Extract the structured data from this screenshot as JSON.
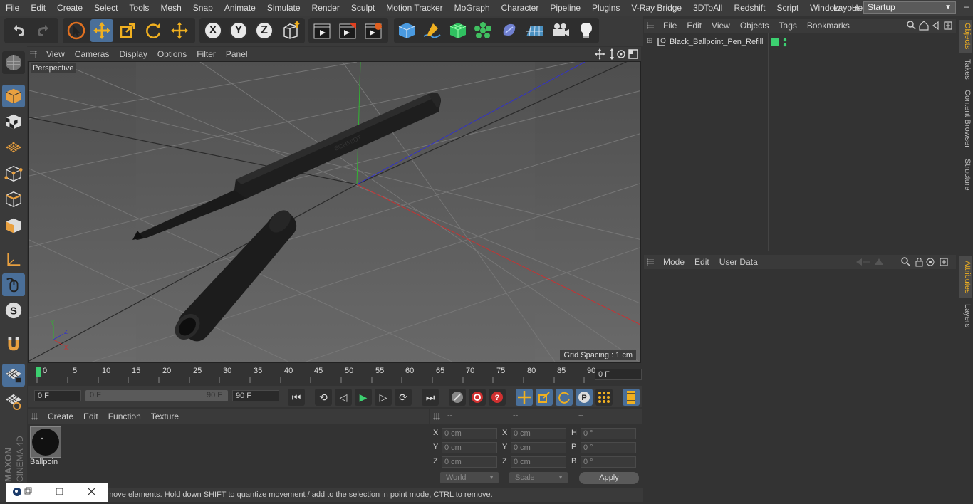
{
  "menubar": {
    "items": [
      "File",
      "Edit",
      "Create",
      "Select",
      "Tools",
      "Mesh",
      "Snap",
      "Animate",
      "Simulate",
      "Render",
      "Sculpt",
      "Motion Tracker",
      "MoGraph",
      "Character",
      "Pipeline",
      "Plugins",
      "V-Ray Bridge",
      "3DToAll",
      "Redshift",
      "Script",
      "Window",
      "Help"
    ],
    "layout_label": "Layout:",
    "layout_value": "Startup"
  },
  "toolbar": {
    "axis_x": "X",
    "axis_y": "Y",
    "axis_z": "Z"
  },
  "viewport": {
    "menu": [
      "View",
      "Cameras",
      "Display",
      "Options",
      "Filter",
      "Panel"
    ],
    "camera_label": "Perspective",
    "grid_spacing": "Grid Spacing : 1 cm",
    "axis_x_color": "#c83232",
    "axis_y_color": "#32b432",
    "axis_z_color": "#3232c8"
  },
  "timeline": {
    "ticks": [
      "0",
      "5",
      "10",
      "15",
      "20",
      "25",
      "30",
      "35",
      "40",
      "45",
      "50",
      "55",
      "60",
      "65",
      "70",
      "75",
      "80",
      "85",
      "90"
    ],
    "current_frame": "0 F",
    "start_field": "0 F",
    "range_start": "0 F",
    "range_end": "90 F",
    "end_field": "90 F"
  },
  "material_manager": {
    "menu": [
      "Create",
      "Edit",
      "Function",
      "Texture"
    ],
    "material_name": "Ballpoin"
  },
  "coordinates": {
    "headers": [
      "--",
      "--",
      "--"
    ],
    "rows": [
      {
        "l1": "X",
        "v1": "0 cm",
        "l2": "X",
        "v2": "0 cm",
        "l3": "H",
        "v3": "0 °"
      },
      {
        "l1": "Y",
        "v1": "0 cm",
        "l2": "Y",
        "v2": "0 cm",
        "l3": "P",
        "v3": "0 °"
      },
      {
        "l1": "Z",
        "v1": "0 cm",
        "l2": "Z",
        "v2": "0 cm",
        "l3": "B",
        "v3": "0 °"
      }
    ],
    "mode_dropdown": "World",
    "scale_dropdown": "Scale",
    "apply_label": "Apply"
  },
  "status": {
    "text": "move elements. Hold down SHIFT to quantize movement / add to the selection in point mode, CTRL to remove."
  },
  "object_manager": {
    "menu": [
      "File",
      "Edit",
      "View",
      "Objects",
      "Tags",
      "Bookmarks"
    ],
    "object_name": "Black_Ballpoint_Pen_Refill"
  },
  "attribute_manager": {
    "menu": [
      "Mode",
      "Edit",
      "User Data"
    ]
  },
  "right_tabs": [
    "Objects",
    "Takes",
    "Content Browser",
    "Structure",
    "Attributes",
    "Layers"
  ],
  "branding": "MAXON CINEMA 4D"
}
